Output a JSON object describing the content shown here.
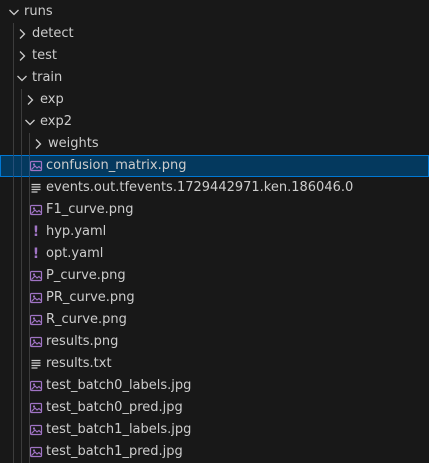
{
  "explorer": {
    "runs": {
      "label": "runs"
    },
    "detect": {
      "label": "detect"
    },
    "test": {
      "label": "test"
    },
    "train": {
      "label": "train"
    },
    "exp": {
      "label": "exp"
    },
    "exp2": {
      "label": "exp2"
    },
    "weights": {
      "label": "weights"
    },
    "files": [
      {
        "label": "confusion_matrix.png",
        "icon": "image-icon",
        "selected": true
      },
      {
        "label": "events.out.tfevents.1729442971.ken.186046.0",
        "icon": "text-lines-icon"
      },
      {
        "label": "F1_curve.png",
        "icon": "image-icon"
      },
      {
        "label": "hyp.yaml",
        "icon": "yaml-icon"
      },
      {
        "label": "opt.yaml",
        "icon": "yaml-icon"
      },
      {
        "label": "P_curve.png",
        "icon": "image-icon"
      },
      {
        "label": "PR_curve.png",
        "icon": "image-icon"
      },
      {
        "label": "R_curve.png",
        "icon": "image-icon"
      },
      {
        "label": "results.png",
        "icon": "image-icon"
      },
      {
        "label": "results.txt",
        "icon": "text-lines-icon"
      },
      {
        "label": "test_batch0_labels.jpg",
        "icon": "image-icon"
      },
      {
        "label": "test_batch0_pred.jpg",
        "icon": "image-icon"
      },
      {
        "label": "test_batch1_labels.jpg",
        "icon": "image-icon"
      },
      {
        "label": "test_batch1_pred.jpg",
        "icon": "image-icon"
      }
    ]
  },
  "colors": {
    "background": "#181818",
    "selection": "#04395e",
    "selection_border": "#0078d4",
    "text": "#cccccc",
    "image_icon": "#a074c4",
    "yaml_icon": "#a074c4",
    "text_icon": "#cccccc"
  }
}
